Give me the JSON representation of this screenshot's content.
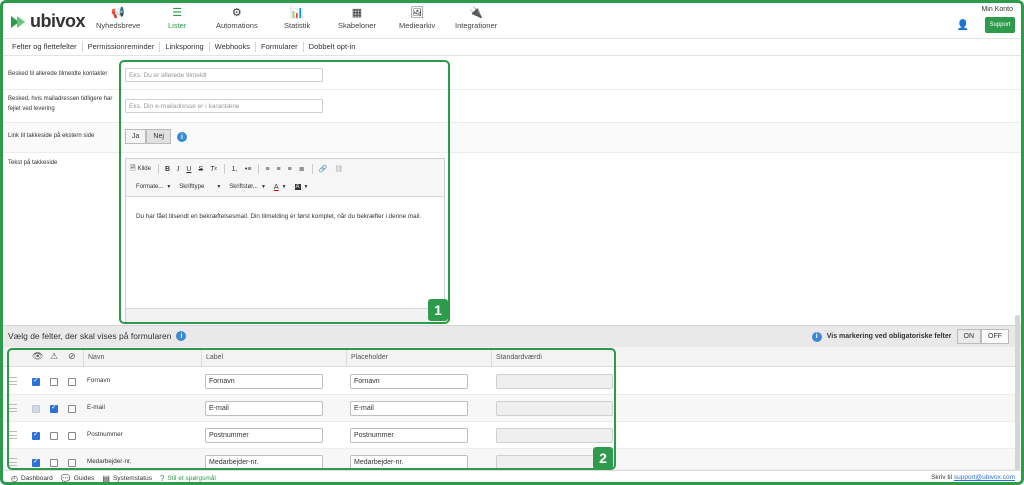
{
  "app": {
    "logo": "ubivox",
    "account_label": "Min Konto",
    "support_label": "Support"
  },
  "nav": [
    {
      "label": "Nyhedsbreve",
      "icon": "megaphone-icon",
      "glyph": "📢"
    },
    {
      "label": "Lister",
      "icon": "list-icon",
      "glyph": "☰"
    },
    {
      "label": "Automations",
      "icon": "automation-icon",
      "glyph": "⚙"
    },
    {
      "label": "Statistik",
      "icon": "chart-icon",
      "glyph": "📊"
    },
    {
      "label": "Skabeloner",
      "icon": "template-icon",
      "glyph": "▦"
    },
    {
      "label": "Mediearkiv",
      "icon": "image-icon",
      "glyph": "🖼"
    },
    {
      "label": "Integrationer",
      "icon": "plug-icon",
      "glyph": "🔌"
    }
  ],
  "subnav": [
    "Felter og flettefelter",
    "Permissionreminder",
    "Linksporing",
    "Webhooks",
    "Formularer",
    "Dobbelt opt-in"
  ],
  "form": {
    "already_label": "Besked til allerede tilmeldte kontakter",
    "already_placeholder": "Eks. Du er allerede tilmeldt",
    "failed_label": "Besked, hvis mailadressen tidligere har fejlet ved levering",
    "failed_placeholder": "Eks. Din e-mailadresse er i karantæne",
    "link_label": "Link til takkeside på ekstern side",
    "toggle_yes": "Ja",
    "toggle_no": "Nej",
    "text_label": "Tekst på takkeside"
  },
  "editor": {
    "source_label": "Kilde",
    "format_label": "Formate...",
    "font_label": "Skrifttype",
    "size_label": "Skriftstør...",
    "body": "Du har fået tilsendt en bekræftelsesmail. Din tilmelding er først komplet, når du bekræfter i denne mail."
  },
  "callouts": {
    "one": "1",
    "two": "2"
  },
  "fields_section": {
    "title": "Vælg de felter, der skal vises på formularen",
    "required_label": "Vis markering ved obligatoriske felter",
    "on_label": "ON",
    "off_label": "OFF"
  },
  "table": {
    "headers": [
      "Navn",
      "Label",
      "Placeholder",
      "Standardværdi"
    ],
    "rows": [
      {
        "name": "Fornavn",
        "label": "Fornavn",
        "placeholder": "Fornavn",
        "show": true,
        "required": false,
        "hidden": false
      },
      {
        "name": "E-mail",
        "label": "E-mail",
        "placeholder": "E-mail",
        "show": true,
        "required": true,
        "hidden": false
      },
      {
        "name": "Postnummer",
        "label": "Postnummer",
        "placeholder": "Postnummer",
        "show": true,
        "required": false,
        "hidden": false
      },
      {
        "name": "Medarbejder-nr.",
        "label": "Medarbejder-nr.",
        "placeholder": "Medarbejder-nr.",
        "show": true,
        "required": false,
        "hidden": false
      }
    ]
  },
  "footer": {
    "dashboard": "Dashboard",
    "guides": "Guides",
    "status": "Systemstatus",
    "ask": "Stil et spørgsmål",
    "write_label": "Skriv til",
    "email": "support@ubivox.com"
  },
  "colors": {
    "accent": "#2e9a4b",
    "info": "#3a88d6"
  }
}
